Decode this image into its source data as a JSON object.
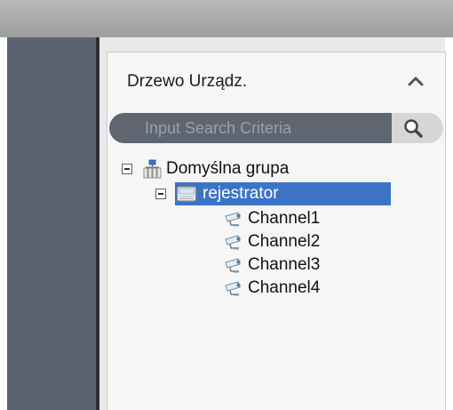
{
  "panel": {
    "title": "Drzewo Urządz."
  },
  "search": {
    "placeholder": "Input Search Criteria"
  },
  "tree": {
    "group_label": "Domyślna grupa",
    "device_label": "rejestrator",
    "channels": [
      {
        "label": "Channel1"
      },
      {
        "label": "Channel2"
      },
      {
        "label": "Channel3"
      },
      {
        "label": "Channel4"
      }
    ]
  },
  "colors": {
    "selection": "#3c73c6",
    "search_bg": "#5f6672",
    "sidebar": "#5c6370"
  }
}
